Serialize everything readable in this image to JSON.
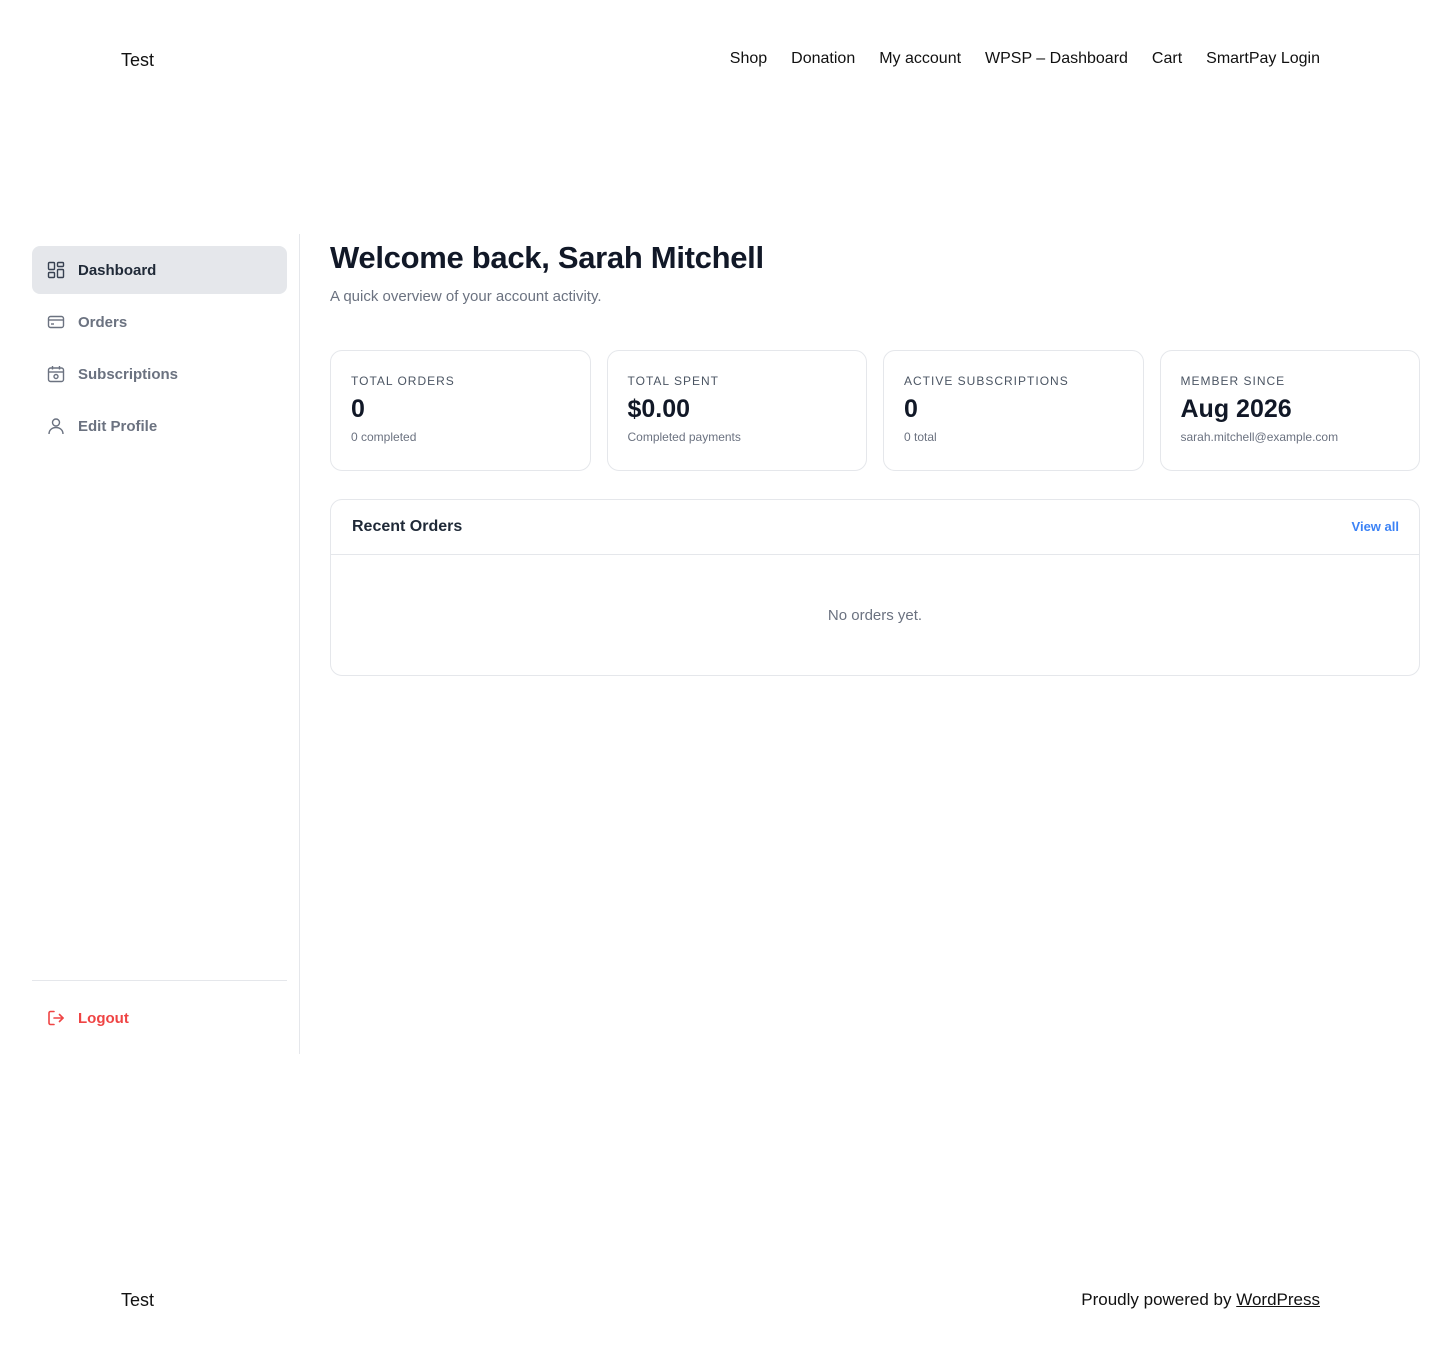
{
  "header": {
    "site_title": "Test",
    "nav": [
      "Shop",
      "Donation",
      "My account",
      "WPSP – Dashboard",
      "Cart",
      "SmartPay Login"
    ]
  },
  "sidebar": {
    "items": [
      {
        "label": "Dashboard",
        "icon": "dashboard-grid-icon"
      },
      {
        "label": "Orders",
        "icon": "credit-card-icon"
      },
      {
        "label": "Subscriptions",
        "icon": "calendar-icon"
      },
      {
        "label": "Edit Profile",
        "icon": "user-icon"
      }
    ],
    "logout": {
      "label": "Logout",
      "icon": "logout-icon",
      "color": "#ef4444"
    }
  },
  "main": {
    "title": "Welcome back, Sarah Mitchell",
    "subtitle": "A quick overview of your account activity.",
    "stats": [
      {
        "label": "TOTAL ORDERS",
        "value": "0",
        "sub": "0 completed"
      },
      {
        "label": "TOTAL SPENT",
        "value": "$0.00",
        "sub": "Completed payments"
      },
      {
        "label": "ACTIVE SUBSCRIPTIONS",
        "value": "0",
        "sub": "0 total"
      },
      {
        "label": "MEMBER SINCE",
        "value": "Aug 2026",
        "sub": "sarah.mitchell@example.com"
      }
    ],
    "recent_orders": {
      "title": "Recent Orders",
      "view_all": "View all",
      "empty": "No orders yet."
    }
  },
  "footer": {
    "site_title": "Test",
    "powered_prefix": "Proudly powered by ",
    "powered_link": "WordPress"
  },
  "colors": {
    "accent": "#3b82f6",
    "danger": "#ef4444",
    "active_bg": "#e5e7eb"
  }
}
